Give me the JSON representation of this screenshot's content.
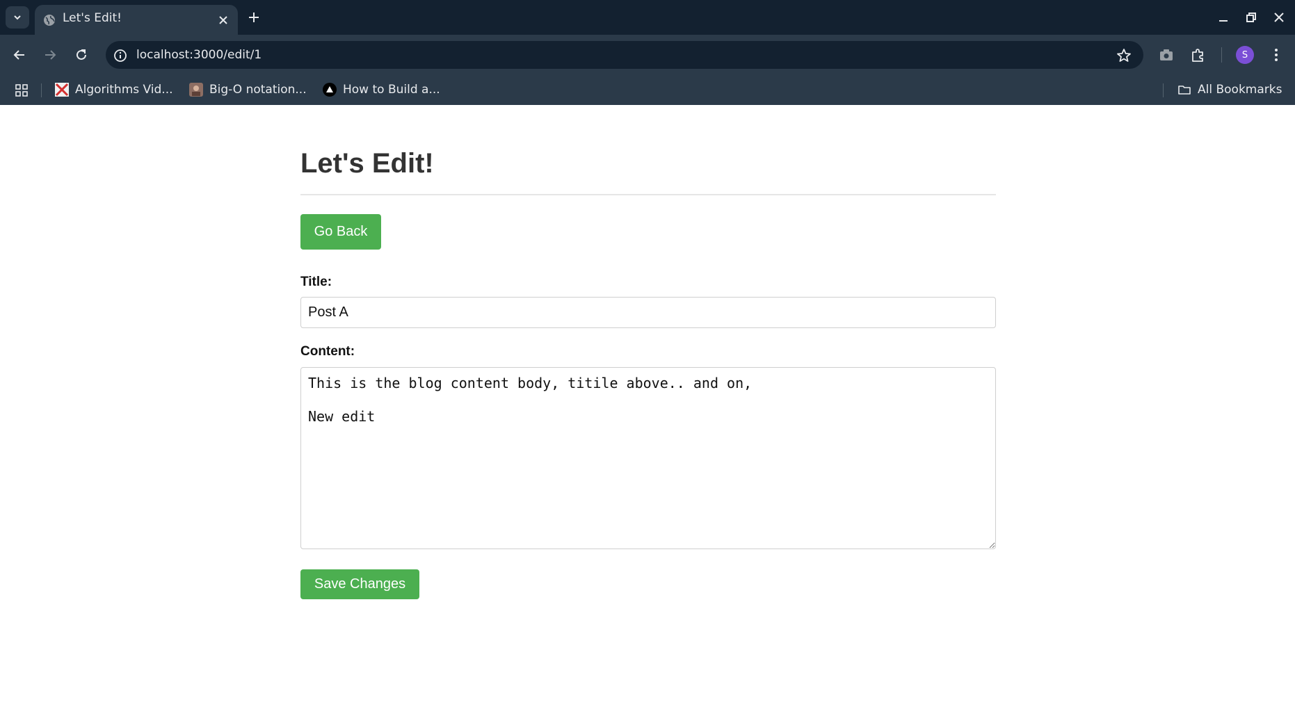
{
  "browser": {
    "tab_title": "Let's Edit!",
    "url": "localhost:3000/edit/1",
    "profile_initial": "S",
    "bookmarks": [
      {
        "label": "Algorithms Vid..."
      },
      {
        "label": "Big-O notation..."
      },
      {
        "label": "How to Build a..."
      }
    ],
    "all_bookmarks_label": "All Bookmarks"
  },
  "page": {
    "heading": "Let's Edit!",
    "go_back_label": "Go Back",
    "title_label": "Title:",
    "title_value": "Post A",
    "content_label": "Content:",
    "content_value": "This is the blog content body, titile above.. and on,\n\nNew edit",
    "save_label": "Save Changes"
  },
  "colors": {
    "accent_button": "#4caf50",
    "chrome_dark": "#132130",
    "chrome_toolbar": "#2b3a49",
    "avatar": "#7b4fd6"
  }
}
